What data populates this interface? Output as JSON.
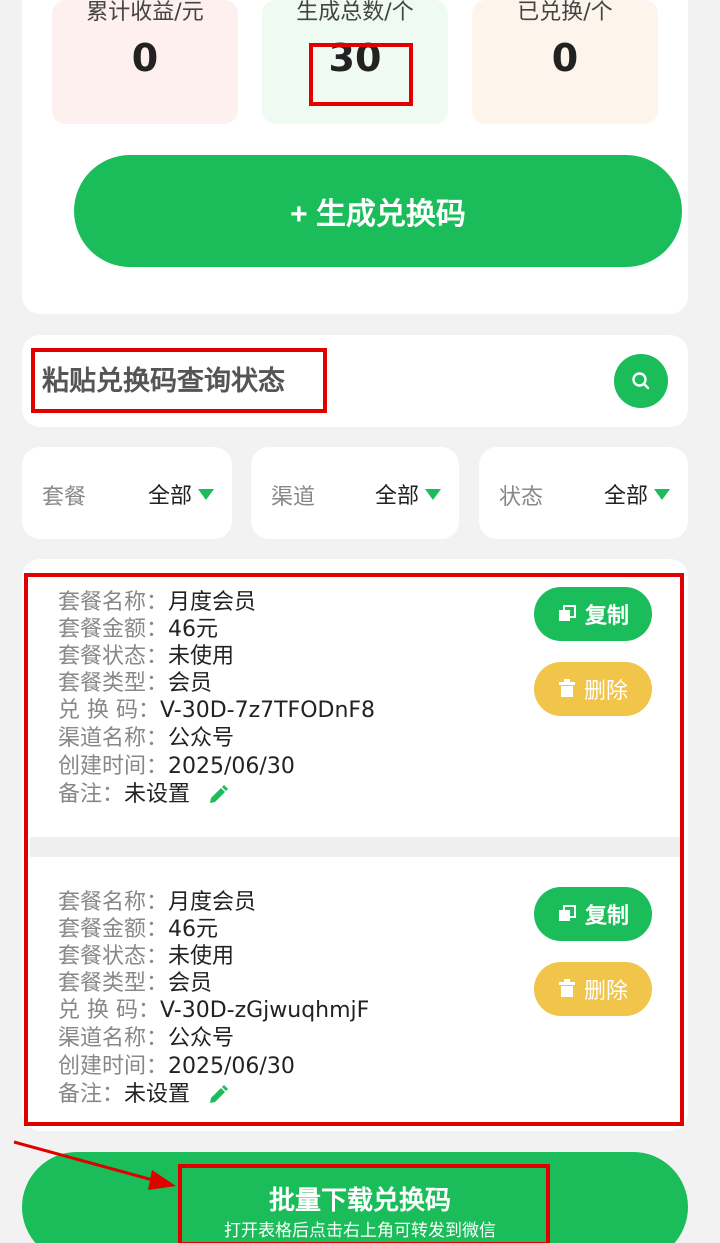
{
  "stats": [
    {
      "label": "累计收益/元",
      "value": "0"
    },
    {
      "label": "生成总数/个",
      "value": "30"
    },
    {
      "label": "已兑换/个",
      "value": "0"
    }
  ],
  "generate_button": "+ 生成兑换码",
  "search": {
    "placeholder": "粘贴兑换码查询状态"
  },
  "filters": [
    {
      "label": "套餐",
      "value": "全部"
    },
    {
      "label": "渠道",
      "value": "全部"
    },
    {
      "label": "状态",
      "value": "全部"
    }
  ],
  "field_labels": {
    "name": "套餐名称：",
    "amount": "套餐金额：",
    "status": "套餐状态：",
    "type": "套餐类型：",
    "code": "兑 换 码：",
    "channel": "渠道名称：",
    "created": "创建时间：",
    "note": "备注："
  },
  "items": [
    {
      "name": "月度会员",
      "amount": "46元",
      "status": "未使用",
      "type": "会员",
      "code": "V-30D-7z7TFODnF8",
      "channel": "公众号",
      "created": "2025/06/30",
      "note": "未设置"
    },
    {
      "name": "月度会员",
      "amount": "46元",
      "status": "未使用",
      "type": "会员",
      "code": "V-30D-zGjwuqhmjF",
      "channel": "公众号",
      "created": "2025/06/30",
      "note": "未设置"
    }
  ],
  "actions": {
    "copy": "复制",
    "delete": "删除"
  },
  "bulk_download": {
    "title": "批量下载兑换码",
    "subtitle": "打开表格后点击右上角可转发到微信"
  },
  "colors": {
    "accent": "#1bbc5a",
    "delete": "#f1c44a",
    "highlight": "#e00000"
  }
}
